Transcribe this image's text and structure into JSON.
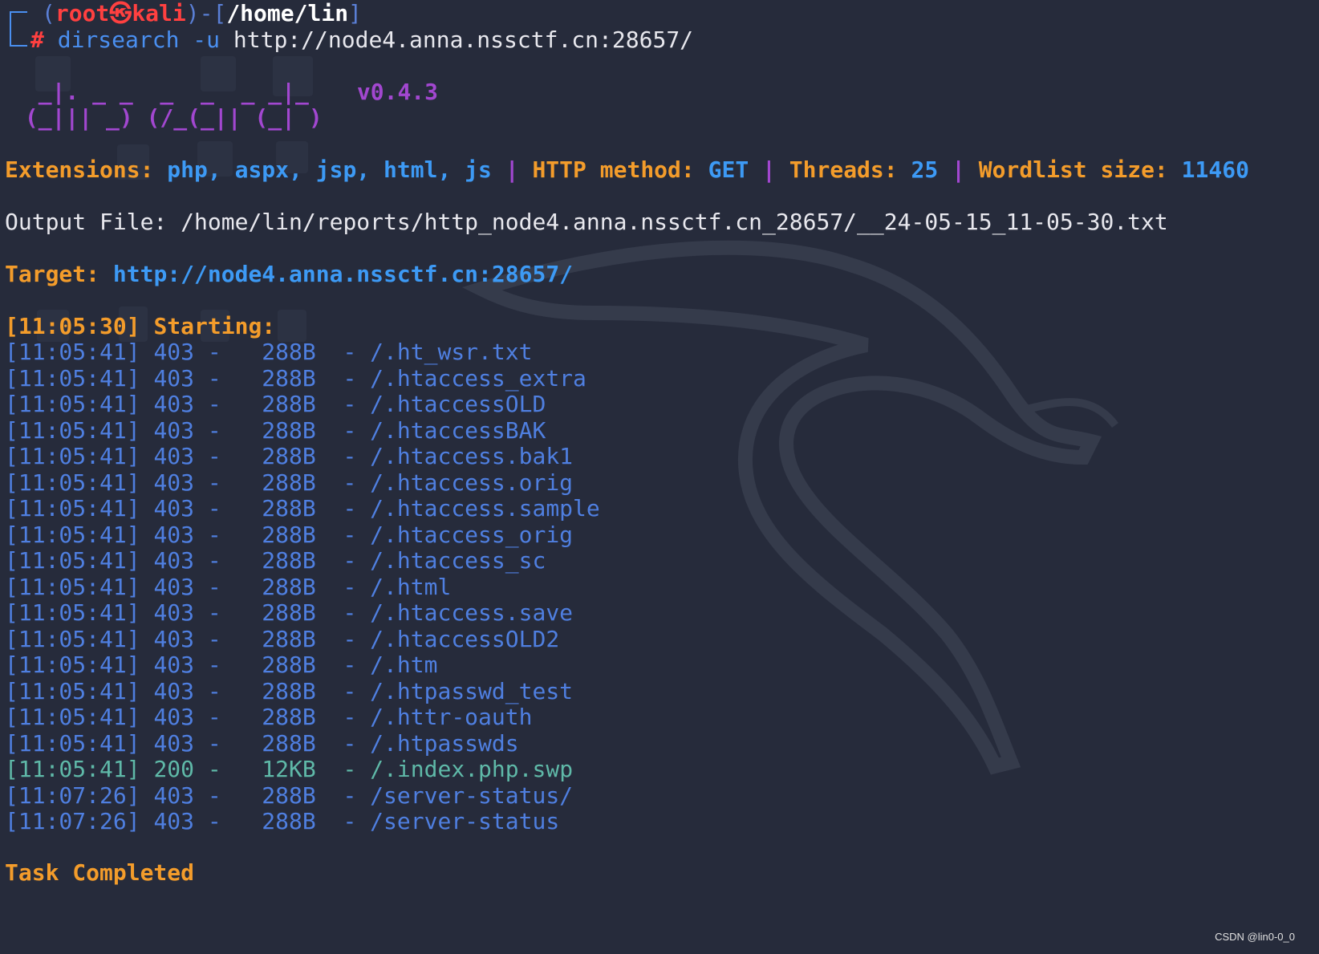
{
  "prompt": {
    "user": "root",
    "skull": "㉿",
    "host": "kali",
    "path": "/home/lin",
    "symbol": "#",
    "command": "dirsearch",
    "flag": "-u",
    "url": "http://node4.anna.nssctf.cn:28657/"
  },
  "banner": {
    "logo_line1": "  _|. _ _  _  _  _ _|_",
    "logo_line2": " (_||| _) (/_(_|| (_| )",
    "version": "v0.4.3"
  },
  "config": {
    "extensions_label": "Extensions:",
    "extensions_value": "php, aspx, jsp, html, js",
    "method_label": "HTTP method:",
    "method_value": "GET",
    "threads_label": "Threads:",
    "threads_value": "25",
    "wordlist_label": "Wordlist size:",
    "wordlist_value": "11460",
    "separator": "|"
  },
  "output_file": {
    "label": "Output File:",
    "value": "/home/lin/reports/http_node4.anna.nssctf.cn_28657/__24-05-15_11-05-30.txt"
  },
  "target": {
    "label": "Target:",
    "value": "http://node4.anna.nssctf.cn:28657/"
  },
  "starting": {
    "time": "[11:05:30]",
    "label": "Starting:"
  },
  "results": [
    {
      "time": "[11:05:41]",
      "status": "403",
      "size": "288B",
      "path": "/.ht_wsr.txt"
    },
    {
      "time": "[11:05:41]",
      "status": "403",
      "size": "288B",
      "path": "/.htaccess_extra"
    },
    {
      "time": "[11:05:41]",
      "status": "403",
      "size": "288B",
      "path": "/.htaccessOLD"
    },
    {
      "time": "[11:05:41]",
      "status": "403",
      "size": "288B",
      "path": "/.htaccessBAK"
    },
    {
      "time": "[11:05:41]",
      "status": "403",
      "size": "288B",
      "path": "/.htaccess.bak1"
    },
    {
      "time": "[11:05:41]",
      "status": "403",
      "size": "288B",
      "path": "/.htaccess.orig"
    },
    {
      "time": "[11:05:41]",
      "status": "403",
      "size": "288B",
      "path": "/.htaccess.sample"
    },
    {
      "time": "[11:05:41]",
      "status": "403",
      "size": "288B",
      "path": "/.htaccess_orig"
    },
    {
      "time": "[11:05:41]",
      "status": "403",
      "size": "288B",
      "path": "/.htaccess_sc"
    },
    {
      "time": "[11:05:41]",
      "status": "403",
      "size": "288B",
      "path": "/.html"
    },
    {
      "time": "[11:05:41]",
      "status": "403",
      "size": "288B",
      "path": "/.htaccess.save"
    },
    {
      "time": "[11:05:41]",
      "status": "403",
      "size": "288B",
      "path": "/.htaccessOLD2"
    },
    {
      "time": "[11:05:41]",
      "status": "403",
      "size": "288B",
      "path": "/.htm"
    },
    {
      "time": "[11:05:41]",
      "status": "403",
      "size": "288B",
      "path": "/.htpasswd_test"
    },
    {
      "time": "[11:05:41]",
      "status": "403",
      "size": "288B",
      "path": "/.httr-oauth"
    },
    {
      "time": "[11:05:41]",
      "status": "403",
      "size": "288B",
      "path": "/.htpasswds"
    },
    {
      "time": "[11:05:41]",
      "status": "200",
      "size": " 12KB",
      "path": "/.index.php.swp"
    },
    {
      "time": "[11:07:26]",
      "status": "403",
      "size": "288B",
      "path": "/server-status/"
    },
    {
      "time": "[11:07:26]",
      "status": "403",
      "size": "288B",
      "path": "/server-status"
    }
  ],
  "completed": "Task Completed",
  "credit": "CSDN @lin0-0_0",
  "colors": {
    "background": "#262b3b",
    "orange": "#f39c2b",
    "blue": "#3d9af5",
    "purple": "#a247d0",
    "red": "#ff4040",
    "green": "#5fb9a8"
  }
}
